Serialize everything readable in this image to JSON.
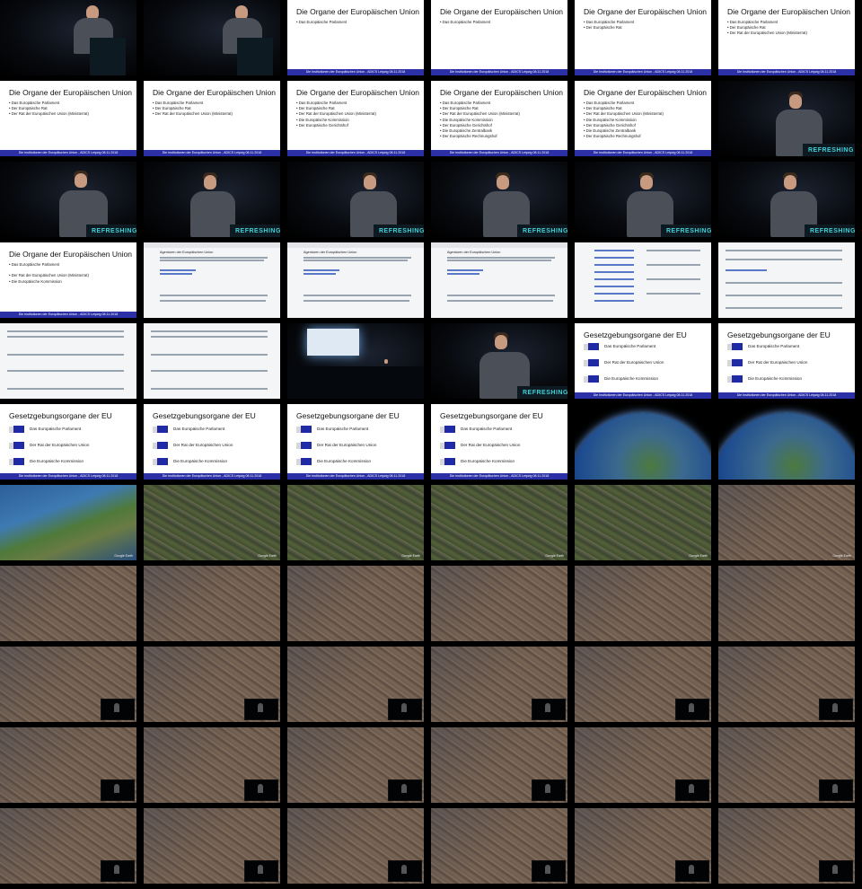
{
  "slides": {
    "title1": "Die Organe der Europäischen Union",
    "title2": "Gesetzgebungsorgane der EU",
    "footer": "Die Institutionen der Europäischen Union - ADICS Leipzig 08.11.2018",
    "items": [
      "Das Europäische Parlament",
      "Der Europäische Rat",
      "Der Rat der Europäischen Union (Ministerrat)",
      "Die Europäische Kommission",
      "Der Europäische Gerichtshof",
      "Die Europäische Zentralbank",
      "Der Europäische Rechnungshof"
    ],
    "organs": [
      "Das Europäische Parlament",
      "Der Rat der Europäischen Union",
      "Die Europäische Kommission"
    ],
    "wiki_heading": "Agenturen der Europäischen Union"
  },
  "stage": {
    "podium_label": "REFRESHING"
  },
  "map": {
    "watermark": "Google Earth"
  }
}
